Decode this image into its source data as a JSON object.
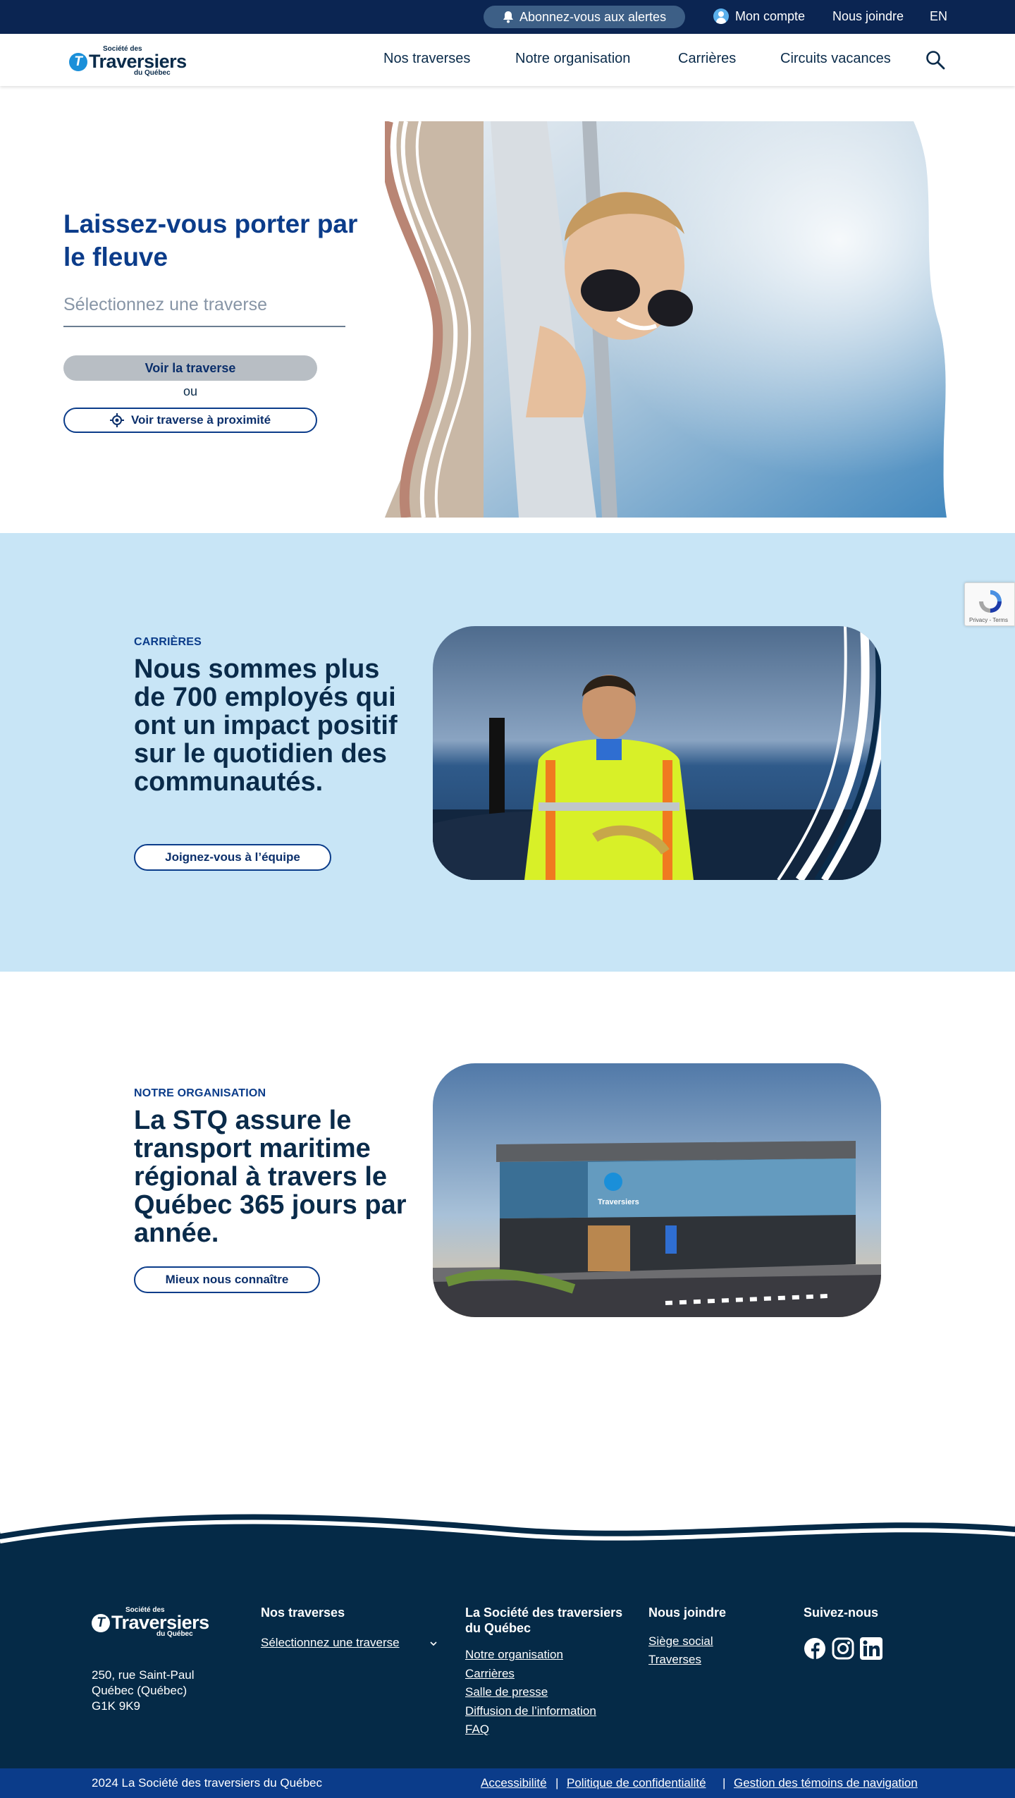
{
  "topbar": {
    "alerts_label": "Abonnez-vous aux alertes",
    "account_label": "Mon compte",
    "contact_label": "Nous joindre",
    "lang_label": "EN"
  },
  "logo": {
    "top": "Société des",
    "main": "Traversiers",
    "bottom": "du Québec",
    "badge": "T"
  },
  "nav": {
    "items": [
      "Nos traverses",
      "Notre organisation",
      "Carrières",
      "Circuits vacances"
    ]
  },
  "hero": {
    "title": "Laissez-vous porter par le fleuve",
    "select_placeholder": "Sélectionnez une traverse",
    "view_button": "Voir la traverse",
    "or_text": "ou",
    "nearby_button": "Voir traverse à proximité"
  },
  "careers": {
    "eyebrow": "CARRIÈRES",
    "title": "Nous sommes plus de 700 employés qui ont un impact positif sur le quotidien des communautés.",
    "button": "Joignez-vous à l’équipe"
  },
  "organisation": {
    "eyebrow": "NOTRE ORGANISATION",
    "title": "La STQ assure le transport maritime régional à travers le Québec 365 jours par année.",
    "button": "Mieux nous connaître",
    "building_sign": "Traversiers"
  },
  "recaptcha": {
    "text": "Privacy - Terms"
  },
  "footer": {
    "address": [
      "250, rue Saint-Paul",
      "Québec (Québec)",
      "G1K 9K9"
    ],
    "col_traverses": {
      "heading": "Nos traverses",
      "select": "Sélectionnez une traverse"
    },
    "col_societe": {
      "heading": "La Société des traversiers du Québec",
      "links": [
        "Notre organisation",
        "Carrières",
        "Salle de presse",
        "Diffusion de l’information",
        "FAQ"
      ]
    },
    "col_contact": {
      "heading": "Nous joindre",
      "links": [
        "Siège social",
        "Traverses"
      ]
    },
    "col_social": {
      "heading": "Suivez-nous"
    },
    "copyright": "2024 La Société des traversiers du Québec",
    "legal_links": [
      "Accessibilité",
      "Politique de confidentialité",
      "Gestion des témoins de navigation"
    ],
    "separator": "|"
  },
  "colors": {
    "navy": "#0b2552",
    "brand_blue": "#0b3c8a",
    "light_blue_bg": "#c8e5f6",
    "footer_bg": "#052a47",
    "accent": "#1a8fd9"
  }
}
